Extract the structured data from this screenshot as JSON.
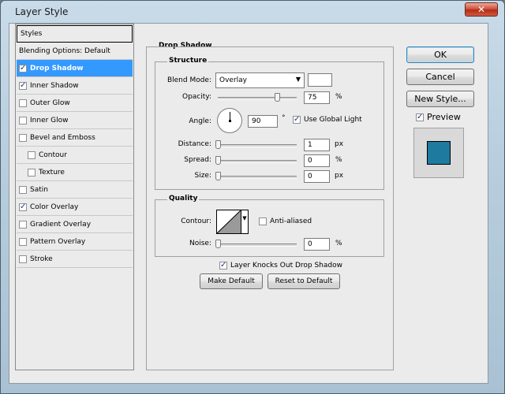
{
  "window": {
    "title": "Layer Style",
    "close_glyph": "✕"
  },
  "styles_panel": {
    "header": "Styles",
    "items": [
      {
        "label": "Blending Options: Default",
        "has_checkbox": false,
        "checked": false,
        "selected": false,
        "indent": false
      },
      {
        "label": "Drop Shadow",
        "has_checkbox": true,
        "checked": true,
        "selected": true,
        "indent": false
      },
      {
        "label": "Inner Shadow",
        "has_checkbox": true,
        "checked": true,
        "selected": false,
        "indent": false
      },
      {
        "label": "Outer Glow",
        "has_checkbox": true,
        "checked": false,
        "selected": false,
        "indent": false
      },
      {
        "label": "Inner Glow",
        "has_checkbox": true,
        "checked": false,
        "selected": false,
        "indent": false
      },
      {
        "label": "Bevel and Emboss",
        "has_checkbox": true,
        "checked": false,
        "selected": false,
        "indent": false
      },
      {
        "label": "Contour",
        "has_checkbox": true,
        "checked": false,
        "selected": false,
        "indent": true
      },
      {
        "label": "Texture",
        "has_checkbox": true,
        "checked": false,
        "selected": false,
        "indent": true
      },
      {
        "label": "Satin",
        "has_checkbox": true,
        "checked": false,
        "selected": false,
        "indent": false
      },
      {
        "label": "Color Overlay",
        "has_checkbox": true,
        "checked": true,
        "selected": false,
        "indent": false
      },
      {
        "label": "Gradient Overlay",
        "has_checkbox": true,
        "checked": false,
        "selected": false,
        "indent": false
      },
      {
        "label": "Pattern Overlay",
        "has_checkbox": true,
        "checked": false,
        "selected": false,
        "indent": false
      },
      {
        "label": "Stroke",
        "has_checkbox": true,
        "checked": false,
        "selected": false,
        "indent": false
      }
    ]
  },
  "drop_shadow": {
    "title": "Drop Shadow",
    "structure": {
      "title": "Structure",
      "blend_mode_label": "Blend Mode:",
      "blend_mode_value": "Overlay",
      "blend_color": "#ffffff",
      "opacity_label": "Opacity:",
      "opacity_value": "75",
      "opacity_unit": "%",
      "opacity_level": 0.75,
      "angle_label": "Angle:",
      "angle_value": "90",
      "angle_unit": "°",
      "use_global_light_label": "Use Global Light",
      "use_global_light_checked": true,
      "distance_label": "Distance:",
      "distance_value": "1",
      "distance_unit": "px",
      "distance_level": 0.0,
      "spread_label": "Spread:",
      "spread_value": "0",
      "spread_unit": "%",
      "spread_level": 0.0,
      "size_label": "Size:",
      "size_value": "0",
      "size_unit": "px",
      "size_level": 0.0
    },
    "quality": {
      "title": "Quality",
      "contour_label": "Contour:",
      "anti_aliased_label": "Anti-aliased",
      "anti_aliased_checked": false,
      "noise_label": "Noise:",
      "noise_value": "0",
      "noise_unit": "%",
      "noise_level": 0.0
    },
    "knocks_out_label": "Layer Knocks Out Drop Shadow",
    "knocks_out_checked": true,
    "make_default_label": "Make Default",
    "reset_default_label": "Reset to Default"
  },
  "buttons": {
    "ok": "OK",
    "cancel": "Cancel",
    "new_style": "New Style...",
    "preview_label": "Preview",
    "preview_checked": true
  },
  "colors": {
    "selection": "#3399ff",
    "preview_swatch": "#1e7a9e",
    "preview_border": "#000000"
  },
  "icons": {
    "dropdown": "chevron-down-icon",
    "checkbox": "checkmark-icon",
    "close": "close-icon"
  }
}
